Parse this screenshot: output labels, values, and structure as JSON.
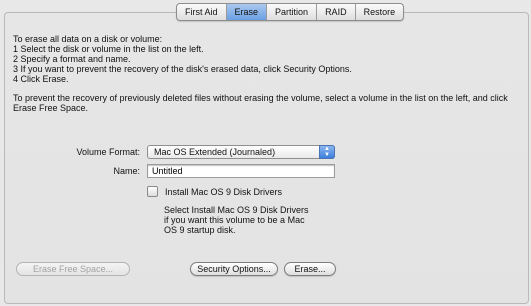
{
  "tabs": [
    "First Aid",
    "Erase",
    "Partition",
    "RAID",
    "Restore"
  ],
  "active_tab": 1,
  "instructions": {
    "intro": "To erase all data on a disk or volume:",
    "steps": [
      "1 Select the disk or volume in the list on the left.",
      "2 Specify a format and name.",
      "3 If you want to prevent the recovery of the disk's erased data, click Security Options.",
      "4 Click Erase."
    ],
    "free_space_note": "To prevent the recovery of previously deleted files without erasing the volume, select a volume in the list on the left, and click Erase Free Space."
  },
  "volume_format": {
    "label": "Volume Format:",
    "value": "Mac OS Extended (Journaled)"
  },
  "name_field": {
    "label": "Name:",
    "value": "Untitled"
  },
  "os9_drivers": {
    "label": "Install Mac OS 9 Disk Drivers",
    "checked": false,
    "help": "Select Install Mac OS 9 Disk Drivers if you want this volume to be a Mac OS 9 startup disk."
  },
  "buttons": {
    "erase_free_space": "Erase Free Space...",
    "security_options": "Security Options...",
    "erase": "Erase..."
  },
  "colors": {
    "selected_tab": "#6a9fe3",
    "popup_arrows": "#3d7fdc"
  }
}
